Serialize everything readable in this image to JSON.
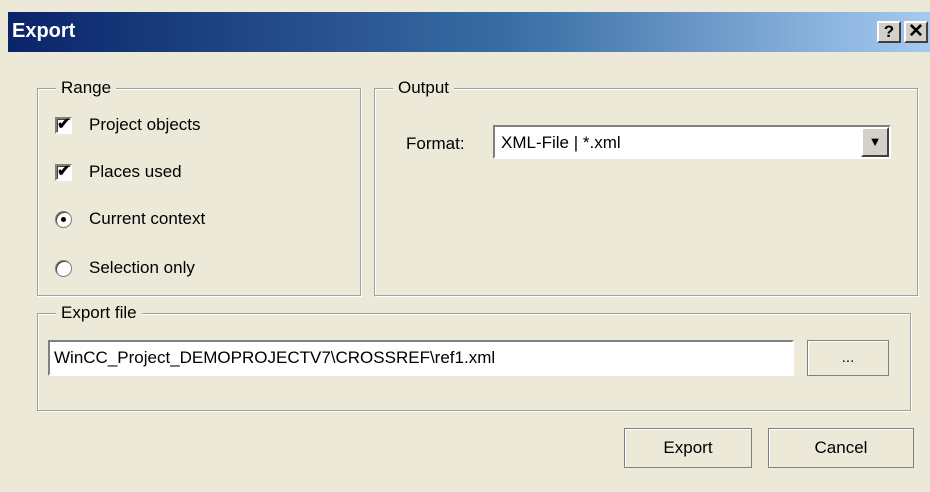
{
  "window": {
    "title": "Export",
    "help_label": "?",
    "close_label": "✕"
  },
  "range": {
    "legend": "Range",
    "items": [
      {
        "type": "checkbox",
        "label": "Project objects",
        "checked": true
      },
      {
        "type": "checkbox",
        "label": "Places used",
        "checked": true
      },
      {
        "type": "radio",
        "label": "Current context",
        "checked": true
      },
      {
        "type": "radio",
        "label": "Selection only",
        "checked": false
      }
    ]
  },
  "output": {
    "legend": "Output",
    "format_label": "Format:",
    "format_value": "XML-File | *.xml",
    "dropdown_icon": "chevron-down-icon"
  },
  "export_file": {
    "legend": "Export file",
    "path": "WinCC_Project_DEMOPROJECTV7\\CROSSREF\\ref1.xml",
    "browse_label": "..."
  },
  "buttons": {
    "export_label": "Export",
    "cancel_label": "Cancel"
  }
}
